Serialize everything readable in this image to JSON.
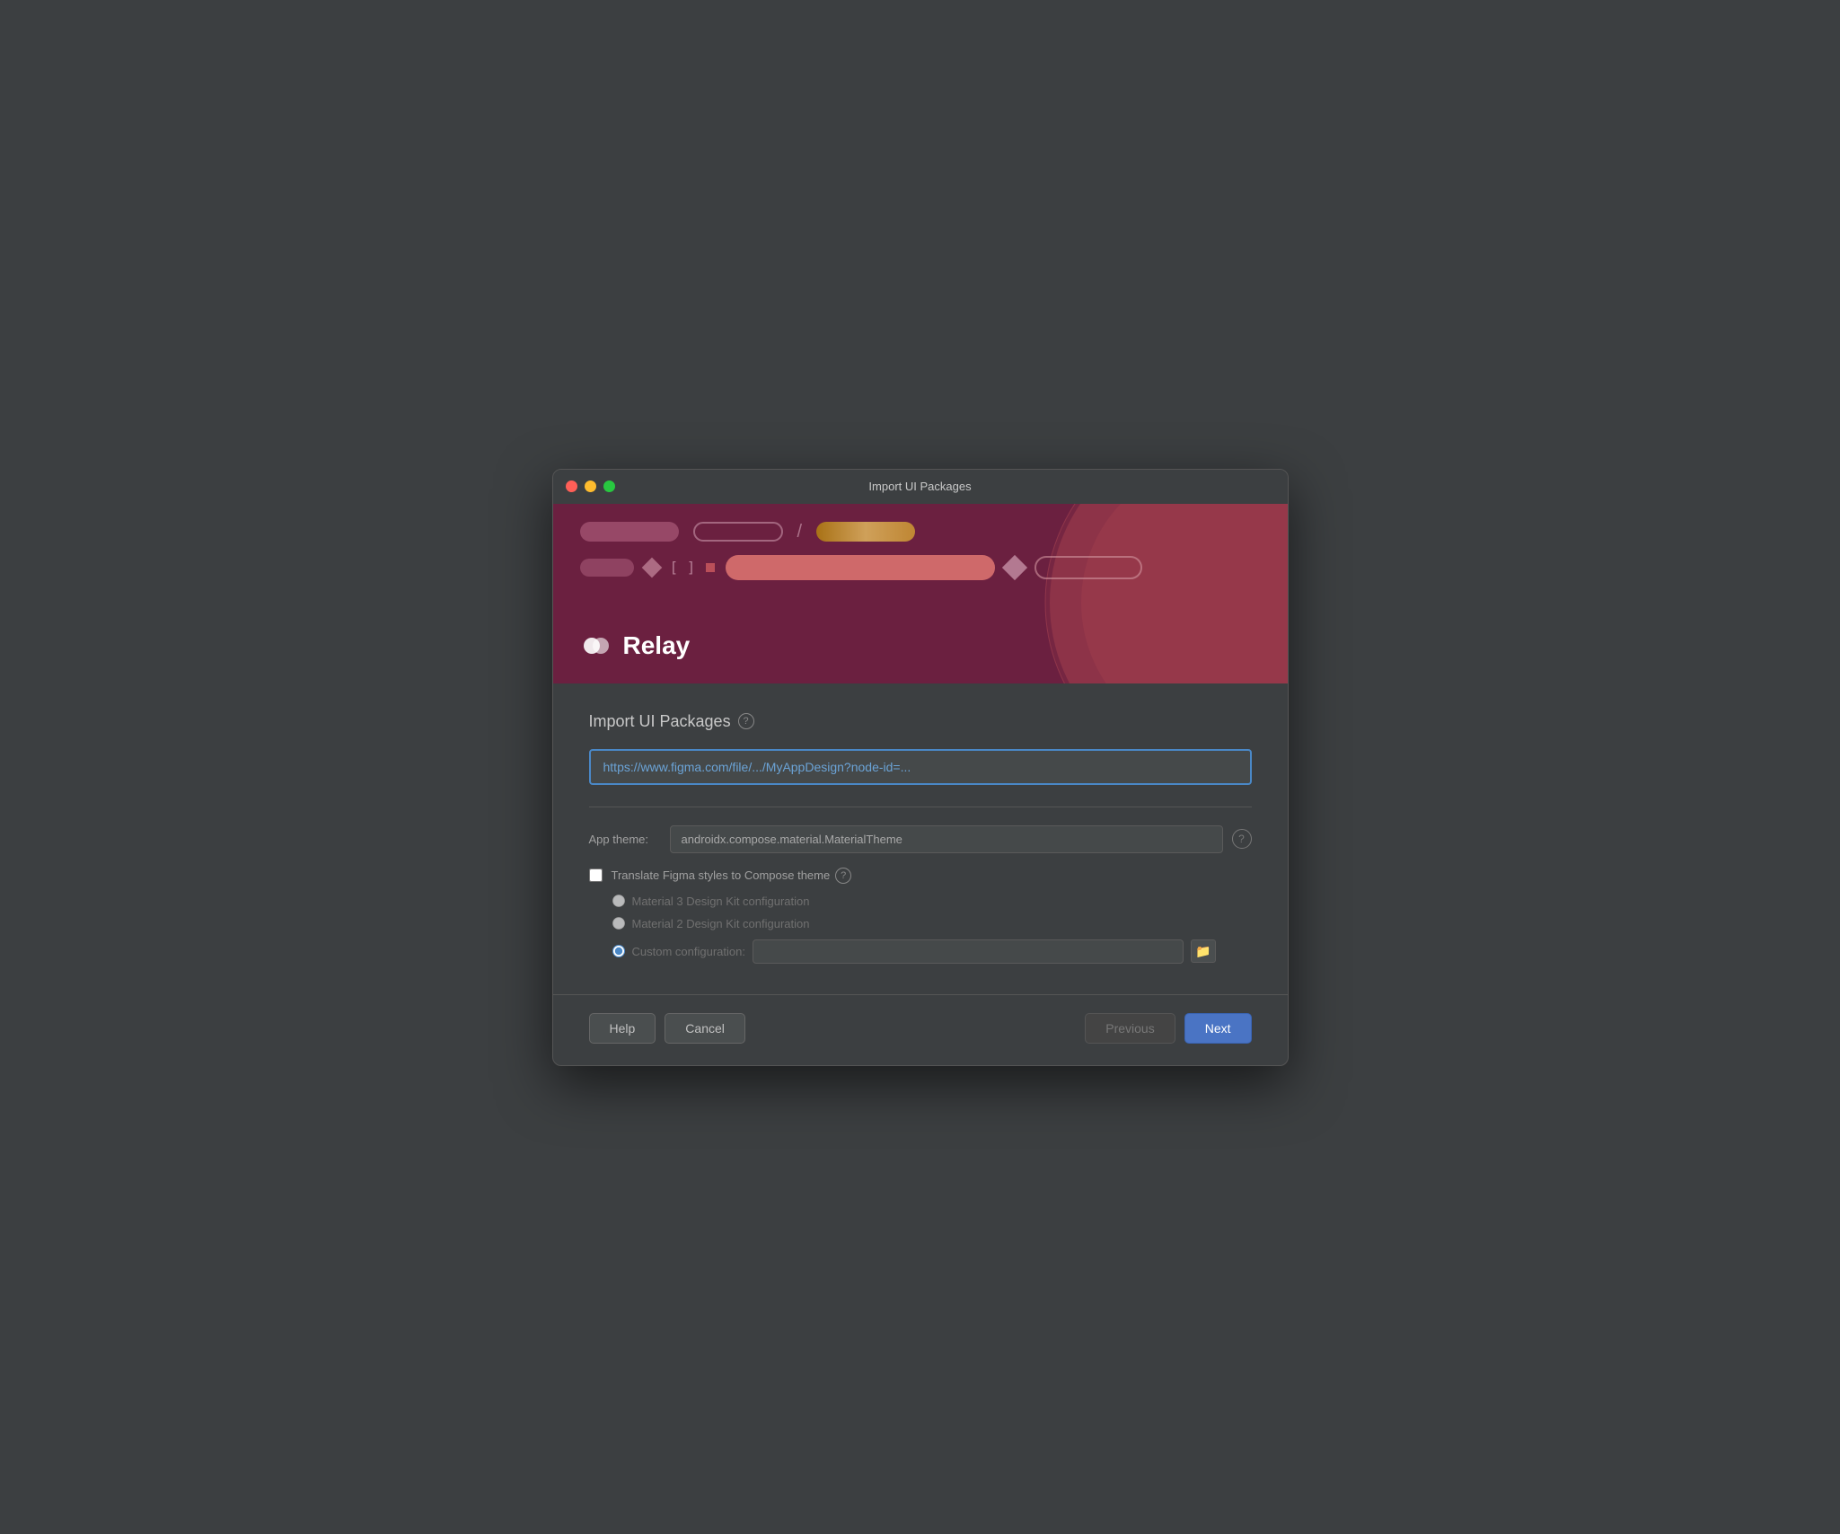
{
  "window": {
    "title": "Import UI Packages"
  },
  "hero": {
    "relay_label": "Relay"
  },
  "main": {
    "section_title": "Import UI Packages",
    "url_placeholder": "https://www.figma.com/file/.../MyAppDesign?node-id=...",
    "url_value": "https://www.figma.com/file/.../MyAppDesign?node-id=...",
    "app_theme_label": "App theme:",
    "app_theme_value": "androidx.compose.material.MaterialTheme",
    "translate_label": "Translate Figma styles to Compose theme",
    "radio_material3": "Material 3 Design Kit configuration",
    "radio_material2": "Material 2 Design Kit configuration",
    "radio_custom": "Custom configuration:",
    "custom_input_value": ""
  },
  "footer": {
    "help_label": "Help",
    "cancel_label": "Cancel",
    "previous_label": "Previous",
    "next_label": "Next"
  }
}
